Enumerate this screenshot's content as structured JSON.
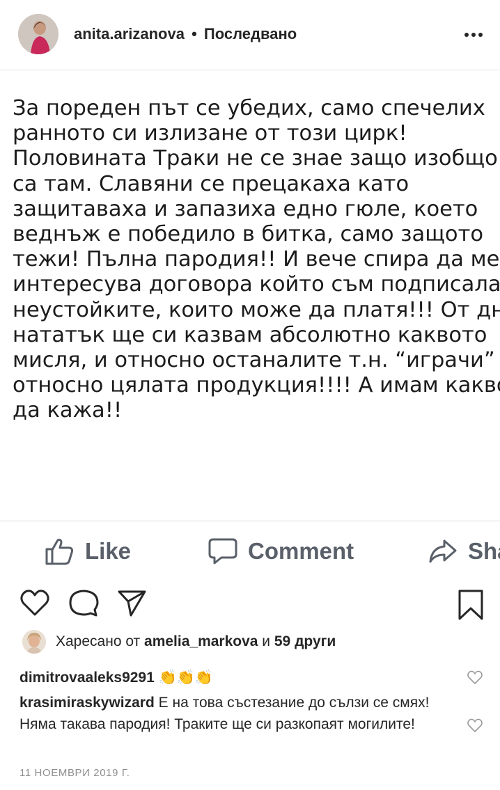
{
  "header": {
    "username": "anita.arizanova",
    "separator": "•",
    "follow_status": "Последвано"
  },
  "post": {
    "text": "За пореден път се убедих, само спечелих\nранното си излизане от този цирк!\nПоловината Траки не се знае защо изобщо\nса там. Славяни се прецакаха като\nзащитаваха и запазиха едно гюле, което\nведнъж е победило в битка, само защото\nтежи! Пълна пародия!! И вече спира да ме\nинтересува договора който съм подписала\nнеустойките, които може да платя!!! От днес\nнататък ще си казвам абсолютно каквото\nмисля, и относно останалите т.н. “играчи”\nотносно цялата продукция!!!! А имам какво\nда кажа!!"
  },
  "fb_actions": {
    "like": "Like",
    "comment": "Comment",
    "share": "Share"
  },
  "likes": {
    "prefix": "Харесано от ",
    "user": "amelia_markova",
    "middle": " и ",
    "others": "59 други"
  },
  "comments": [
    {
      "user": "dimitrovaaleks9291",
      "text": " 👏👏👏"
    },
    {
      "user": "krasimiraskywizard",
      "text": " Е на това състезание до сълзи се смях! Няма такава пародия! Траките ще си разкопаят могилите!"
    }
  ],
  "date": "11 НОЕМВРИ 2019 Г.",
  "icons": [
    "more-icon",
    "thumbs-up-icon",
    "comment-bubble-icon",
    "share-arrow-icon",
    "heart-icon",
    "comment-icon",
    "send-icon",
    "bookmark-icon",
    "small-heart-icon"
  ]
}
